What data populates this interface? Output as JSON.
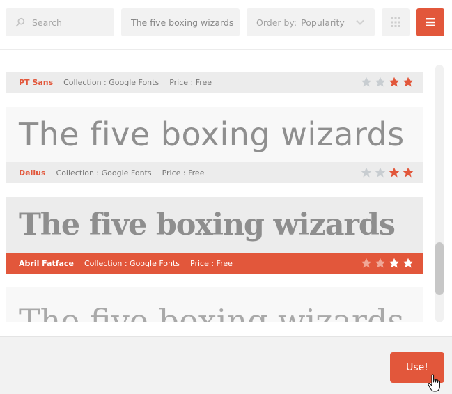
{
  "toolbar": {
    "search_placeholder": "Search",
    "sample_text": "The five boxing wizards",
    "order_label": "Order by:",
    "order_value": "Popularity"
  },
  "fonts": [
    {
      "name": "PT Sans",
      "collection": "Collection : Google Fonts",
      "price": "Price : Free",
      "rating": 2,
      "max_rating": 4
    },
    {
      "name": "Delius",
      "preview": "The five boxing wizards",
      "collection": "Collection : Google Fonts",
      "price": "Price : Free",
      "rating": 2,
      "max_rating": 4
    },
    {
      "name": "Abril Fatface",
      "preview": "The five boxing wizards",
      "collection": "Collection : Google Fonts",
      "price": "Price : Free",
      "rating": 2,
      "max_rating": 4,
      "selected": true
    },
    {
      "preview": "The five boxing wizards"
    }
  ],
  "footer": {
    "use_label": "Use!"
  },
  "colors": {
    "accent": "#e2573b",
    "star_off": "#c8cdd1",
    "bar": "#ececec"
  }
}
